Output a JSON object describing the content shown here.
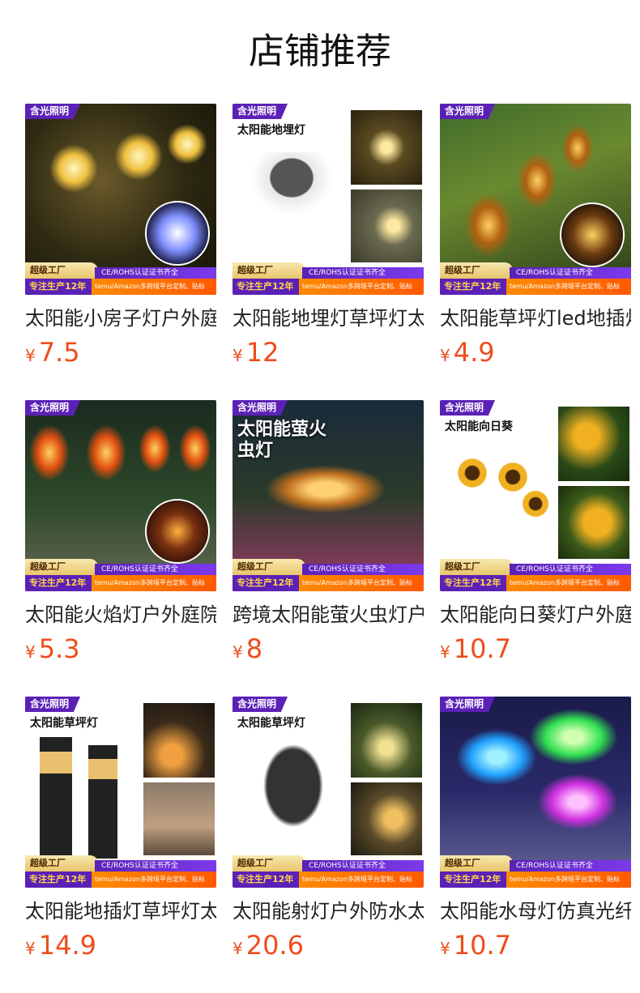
{
  "page_title": "店铺推荐",
  "badges": {
    "brand": "含光照明",
    "factory": "超级工厂",
    "cert": "CE/ROHS认证证书齐全",
    "years": "专注生产12年",
    "custom": "temu/Amazon多跨境平台定制、贴标"
  },
  "currency": "¥",
  "products": [
    {
      "name": "太阳能小房子灯户外庭院",
      "price": "7.5",
      "promo": ""
    },
    {
      "name": "太阳能地埋灯草坪灯太阳能",
      "price": "12",
      "promo": "太阳能地埋灯"
    },
    {
      "name": "太阳能草坪灯led地插灯",
      "price": "4.9",
      "promo": ""
    },
    {
      "name": "太阳能火焰灯户外庭院灯",
      "price": "5.3",
      "promo": ""
    },
    {
      "name": "跨境太阳能萤火虫灯户外",
      "price": "8",
      "promo": "太阳能萤火虫灯"
    },
    {
      "name": "太阳能向日葵灯户外庭院",
      "price": "10.7",
      "promo": "太阳能向日葵"
    },
    {
      "name": "太阳能地插灯草坪灯太阳能",
      "price": "14.9",
      "promo": "太阳能草坪灯"
    },
    {
      "name": "太阳能射灯户外防水太阳能",
      "price": "20.6",
      "promo": "太阳能草坪灯"
    },
    {
      "name": "太阳能水母灯仿真光纤灯",
      "price": "10.7",
      "promo": ""
    }
  ]
}
